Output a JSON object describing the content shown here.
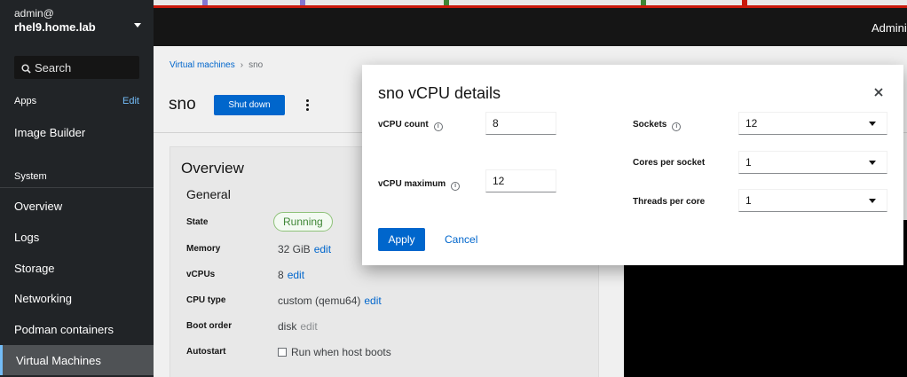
{
  "colors": {
    "accent": "#0066cc",
    "sidebar_bg": "#212427",
    "masthead_bg": "#151515",
    "top_alert_line": "#c9190b",
    "running_green": "#3e8635",
    "tab_strip": [
      "#3e8635",
      "#8476d1",
      "#8476d1",
      "#3e8635",
      "#3e8635",
      "#c9190b"
    ]
  },
  "sidebar": {
    "user": "admin@",
    "host": "rhel9.home.lab",
    "search_label": "Search",
    "apps_label": "Apps",
    "apps_edit": "Edit",
    "app_items": [
      "Image Builder"
    ],
    "system_label": "System",
    "items": [
      {
        "label": "Overview"
      },
      {
        "label": "Logs"
      },
      {
        "label": "Storage"
      },
      {
        "label": "Networking"
      },
      {
        "label": "Podman containers"
      },
      {
        "label": "Virtual Machines",
        "active": true
      }
    ]
  },
  "masthead": {
    "admin_text": "Adminis"
  },
  "main": {
    "breadcrumb": {
      "parent": "Virtual machines",
      "current": "sno"
    },
    "vm_name": "sno",
    "shutdown_label": "Shut down",
    "overview": {
      "title": "Overview",
      "general_title": "General",
      "rows": [
        {
          "key": "State",
          "value": "Running"
        },
        {
          "key": "Memory",
          "value": "32 GiB",
          "link": "edit"
        },
        {
          "key": "vCPUs",
          "value": "8",
          "link": "edit"
        },
        {
          "key": "CPU type",
          "value": "custom (qemu64)",
          "link": "edit"
        },
        {
          "key": "Boot order",
          "value": "disk",
          "link": "edit"
        },
        {
          "key": "Autostart",
          "value": "Run when host boots"
        }
      ]
    }
  },
  "modal": {
    "title": "sno vCPU details",
    "vcpu_count_label": "vCPU count",
    "vcpu_count_value": "8",
    "vcpu_max_label": "vCPU maximum",
    "vcpu_max_value": "12",
    "sockets_label": "Sockets",
    "sockets_value": "12",
    "cores_label": "Cores per socket",
    "cores_value": "1",
    "threads_label": "Threads per core",
    "threads_value": "1",
    "apply_label": "Apply",
    "cancel_label": "Cancel",
    "info_glyph": "i",
    "close_icon": "close-icon"
  }
}
